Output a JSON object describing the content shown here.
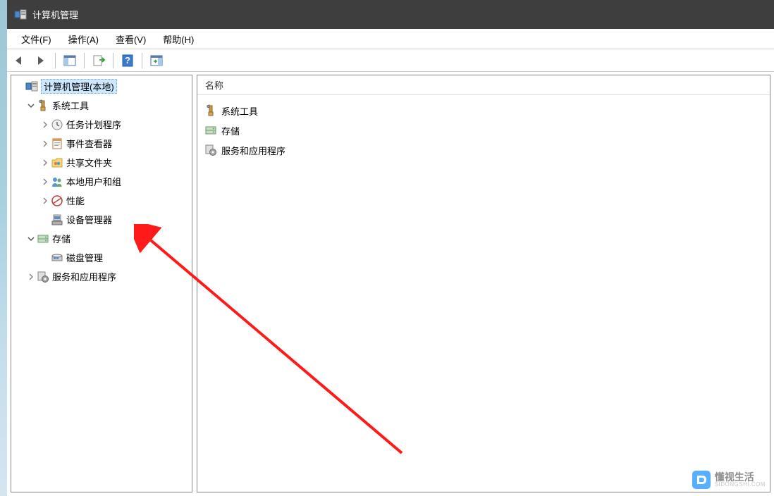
{
  "window": {
    "title": "计算机管理"
  },
  "menus": {
    "file": "文件(F)",
    "action": "操作(A)",
    "view": "查看(V)",
    "help": "帮助(H)"
  },
  "tree": {
    "root": {
      "label": "计算机管理(本地)",
      "selected": true
    },
    "system_tools": {
      "label": "系统工具",
      "children": {
        "task_scheduler": "任务计划程序",
        "event_viewer": "事件查看器",
        "shared_folders": "共享文件夹",
        "local_users": "本地用户和组",
        "performance": "性能",
        "device_manager": "设备管理器"
      }
    },
    "storage": {
      "label": "存储",
      "children": {
        "disk_management": "磁盘管理"
      }
    },
    "services": {
      "label": "服务和应用程序"
    }
  },
  "list": {
    "header_name": "名称",
    "items": {
      "system_tools": "系统工具",
      "storage": "存储",
      "services": "服务和应用程序"
    }
  },
  "watermark": {
    "brand": "懂视生活",
    "sub": "SIDONGSHI.COM"
  }
}
